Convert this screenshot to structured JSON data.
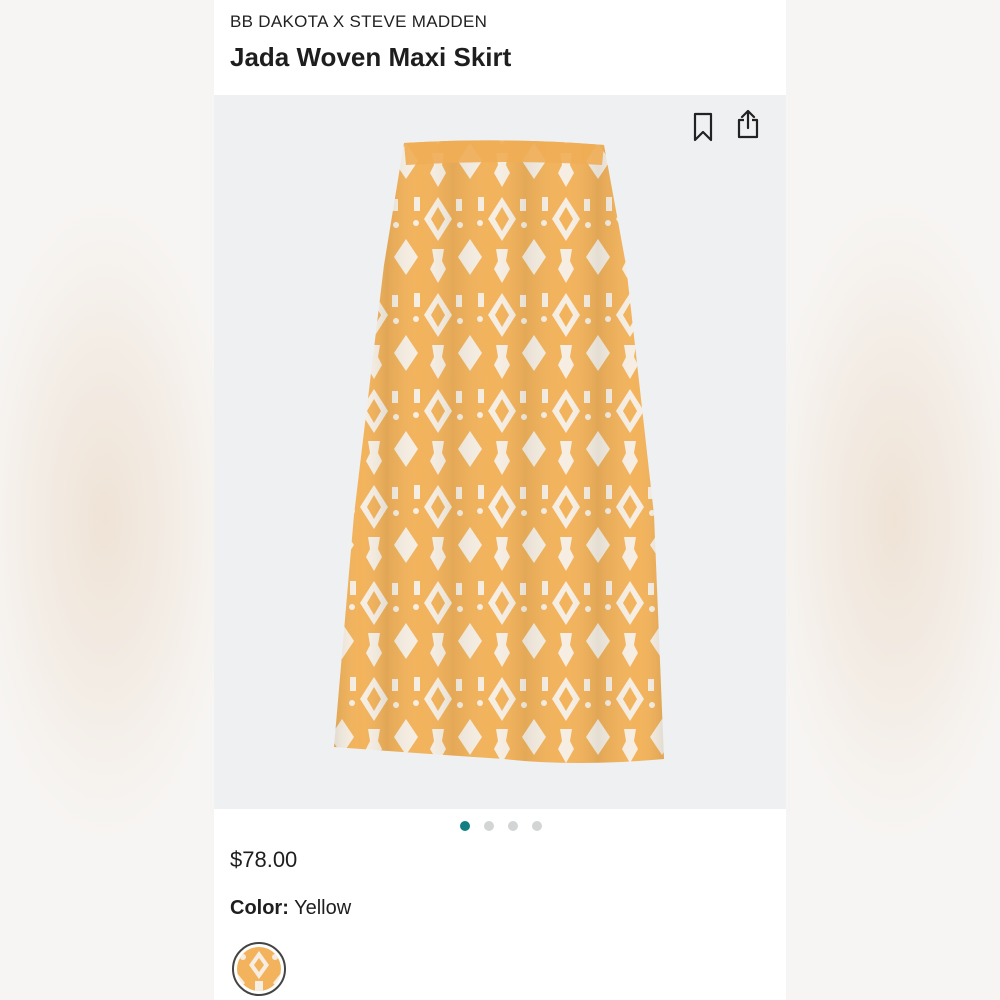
{
  "product": {
    "brand": "BB DAKOTA X STEVE MADDEN",
    "title": "Jada Woven Maxi Skirt",
    "price": "$78.00",
    "color_label": "Color:",
    "color_value": "Yellow"
  },
  "gallery": {
    "image_count": 4,
    "active_index": 0,
    "icons": [
      "bookmark-icon",
      "share-icon"
    ]
  },
  "colors": {
    "accent": "#117f82",
    "skirt_base": "#f2b35c",
    "skirt_pattern": "#f6eee2"
  }
}
